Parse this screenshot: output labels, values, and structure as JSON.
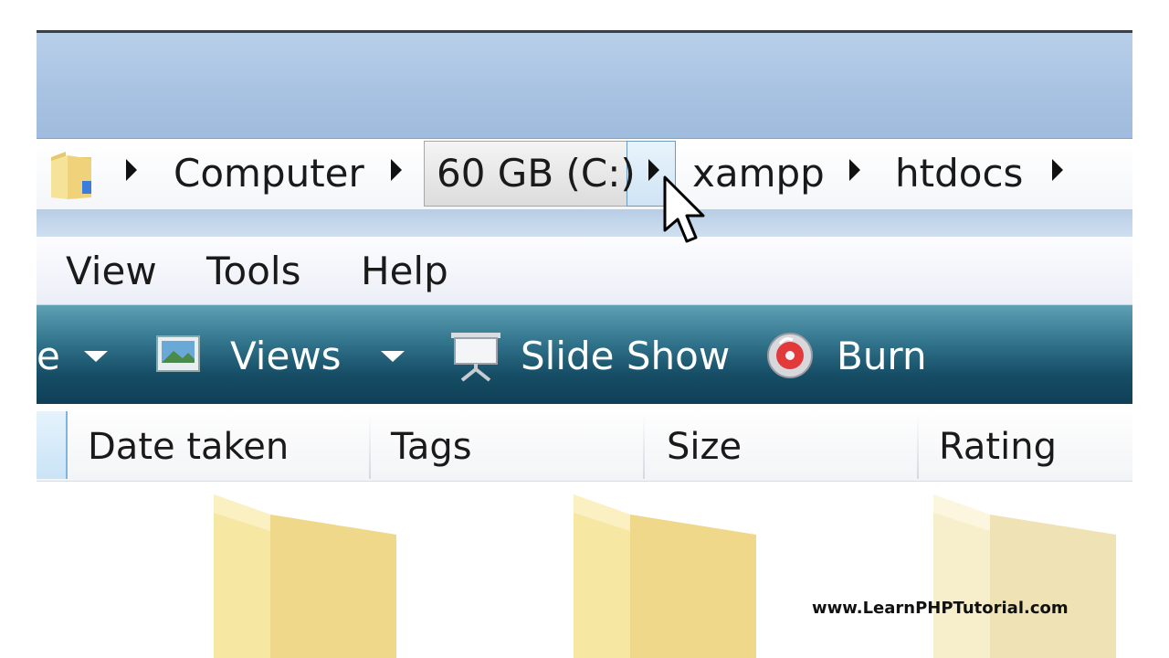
{
  "address_bar": {
    "crumbs": [
      "Computer",
      "60 GB (C:)",
      "xampp",
      "htdocs"
    ]
  },
  "menu": {
    "items": [
      "View",
      "Tools",
      "Help"
    ]
  },
  "command_bar": {
    "partial_label": "e",
    "views_label": "Views",
    "slideshow_label": "Slide Show",
    "burn_label": "Burn"
  },
  "columns": {
    "headers": [
      "Date taken",
      "Tags",
      "Size",
      "Rating"
    ]
  },
  "watermark": "www.LearnPHPTutorial.com",
  "colors": {
    "title_bar": "#a6c1e1",
    "command_bar": "#164e66",
    "folder": "#f2dc8a"
  }
}
